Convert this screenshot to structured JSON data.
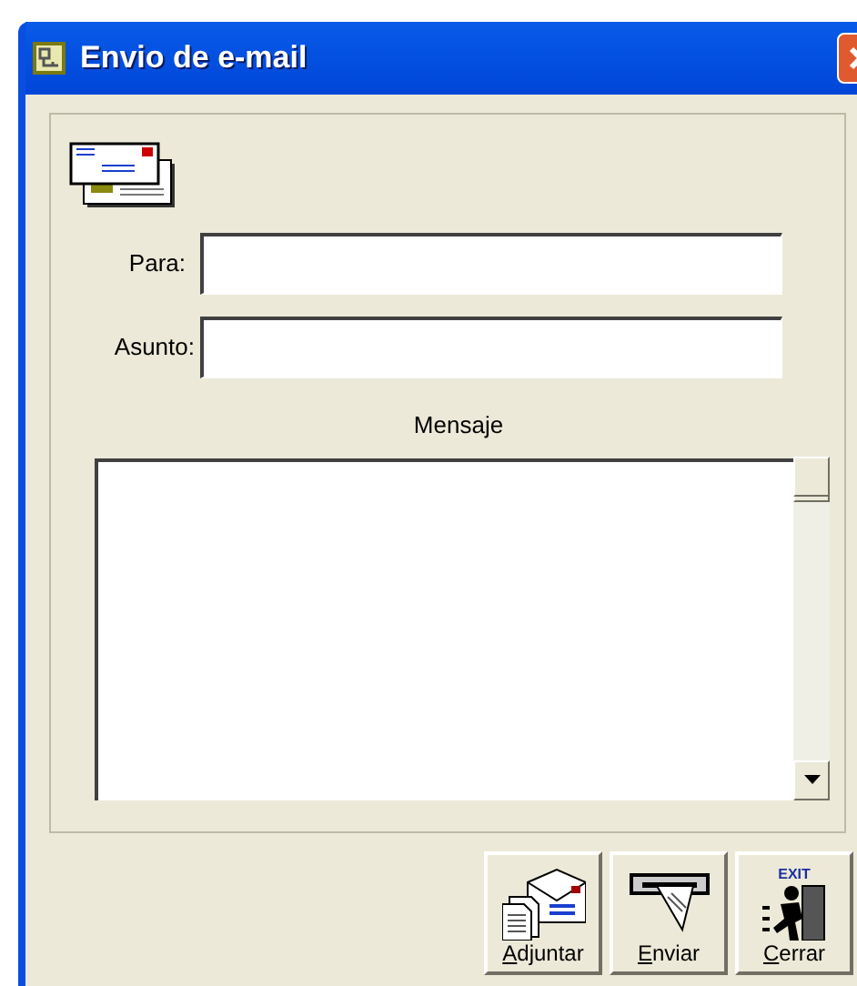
{
  "window": {
    "title": "Envio de e-mail"
  },
  "fields": [
    {
      "label": "Para:"
    },
    {
      "label": "Asunto:"
    }
  ],
  "message": {
    "label": "Mensaje"
  },
  "buttons": [
    {
      "kind": "attach",
      "accel": "A",
      "rest": "djuntar"
    },
    {
      "kind": "send",
      "accel": "E",
      "rest": "nviar"
    },
    {
      "kind": "exit",
      "accel": "C",
      "rest": "errar",
      "badge": "EXIT"
    }
  ]
}
